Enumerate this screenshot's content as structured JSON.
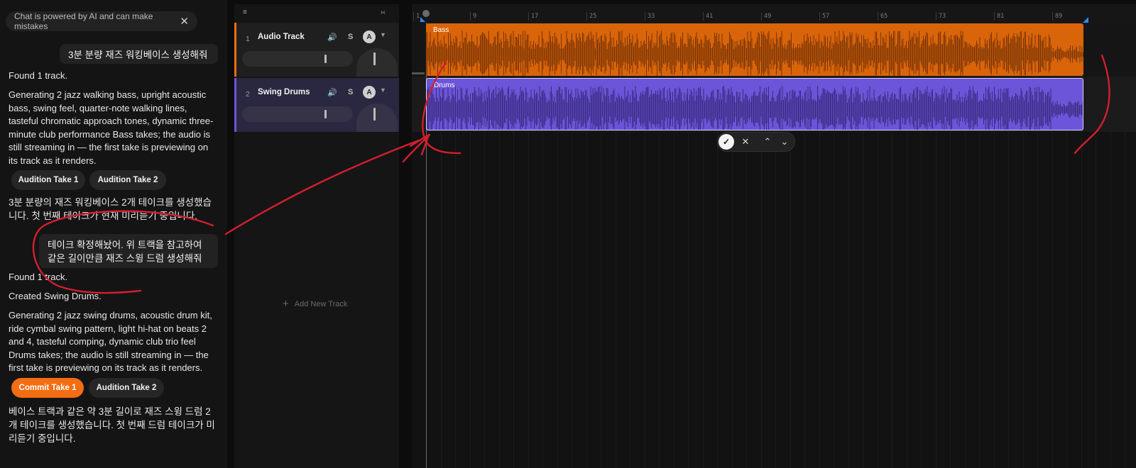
{
  "chat": {
    "notice": "Chat is powered by AI and can make mistakes",
    "notice_close": "✕",
    "user_message_1": "3분 분량 재즈 워킹베이스 생성해줘",
    "found_1": "Found 1 track.",
    "generating_1": "Generating 2 jazz walking bass, upright acoustic bass, swing feel, quarter-note walking lines, tasteful chromatic approach tones, dynamic three-minute club performance Bass takes; the audio is still streaming in — the first take is previewing on its track as it renders.",
    "audition_take_1": "Audition Take 1",
    "audition_take_2": "Audition Take 2",
    "korean_reply_1": "3분 분량의 재즈 워킹베이스 2개 테이크를 생성했습니다. 첫 번째 테이크가 현재 미리듣기 중입니다.",
    "user_message_2": "테이크 확정해놨어. 위 트랙을 참고하여 같은 길이만큼 재즈 스윙 드럼 생성해줘",
    "found_2": "Found 1 track.",
    "created": "Created Swing Drums.",
    "generating_2": "Generating 2 jazz swing drums, acoustic drum kit, ride cymbal swing pattern, light hi-hat on beats 2 and 4, tasteful comping, dynamic club trio feel Drums takes; the audio is still streaming in — the first take is previewing on its track as it renders.",
    "commit_take_1": "Commit Take 1",
    "audition_take_2b": "Audition Take 2",
    "korean_reply_2": "베이스 트랙과 같은 약 3분 길이로 재즈 스윙 드럼 2개 테이크를 생성했습니다. 첫 번째 드럼 테이크가 미리듣기 중입니다."
  },
  "tracks": [
    {
      "number": "1",
      "name": "Audio Track",
      "solo": "S",
      "avatar": "A",
      "color": "#f36d12"
    },
    {
      "number": "2",
      "name": "Swing Drums",
      "solo": "S",
      "avatar": "A",
      "color": "#6f55d6"
    }
  ],
  "add_track": "Add New Track",
  "ruler": [
    "1",
    "9",
    "17",
    "25",
    "33",
    "41",
    "49",
    "57",
    "65",
    "73",
    "81",
    "89"
  ],
  "clips": [
    {
      "label": "Bass",
      "color": "#d9640a",
      "wave": "#7a3607"
    },
    {
      "label": "Drums",
      "color": "#6c55d8",
      "wave": "#3a2c80"
    }
  ],
  "take_bar": {
    "confirm": "✓",
    "reject": "✕",
    "up": "⌃",
    "down": "⌄"
  },
  "colors": {
    "accent": "#f36d12",
    "drums": "#6f55d6",
    "annotation": "#d31f2e"
  }
}
